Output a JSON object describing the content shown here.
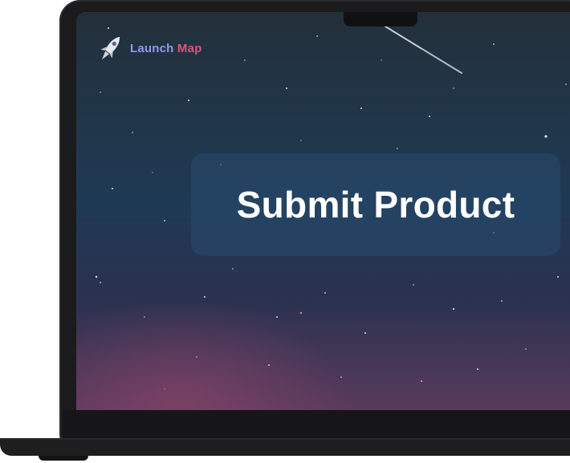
{
  "brand": {
    "name_part1": "Launch",
    "name_part2": "Map",
    "icon": "rocket-icon",
    "color_part1": "#8f98f0",
    "color_part2": "#e2507e"
  },
  "hero": {
    "title": "Submit Product"
  },
  "colors": {
    "bezel": "#1b1b1d",
    "sky_top": "#23303a",
    "sky_mid": "#1f3a55",
    "sky_bottom": "#5a3b5c"
  }
}
